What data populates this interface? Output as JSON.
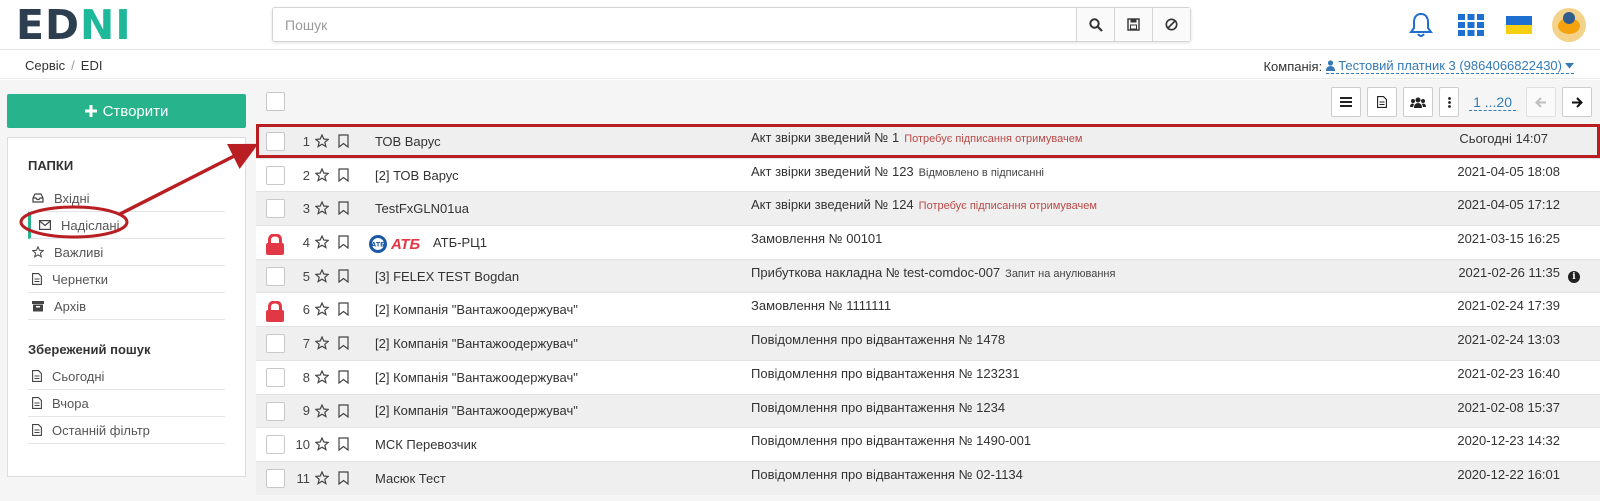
{
  "header": {
    "logo_part1": "ED",
    "logo_part2": "NI",
    "search_placeholder": "Пошук",
    "icons": [
      "search-icon",
      "save-icon",
      "ban-icon",
      "bell-icon",
      "apps-grid-icon",
      "ukraine-flag-icon",
      "user-avatar"
    ]
  },
  "breadcrumb": {
    "items": [
      "Сервіс",
      "EDI"
    ],
    "separator": "/"
  },
  "company": {
    "label": "Компанія:",
    "value": "Тестовий платник 3 (9864066822430)"
  },
  "sidebar": {
    "create_label": "Створити",
    "folders_title": "ПАПКИ",
    "folders": [
      {
        "label": "Вхідні",
        "icon": "inbox-icon"
      },
      {
        "label": "Надіслані",
        "icon": "envelope-icon",
        "active": true
      },
      {
        "label": "Важливі",
        "icon": "star-icon"
      },
      {
        "label": "Чернетки",
        "icon": "file-icon"
      },
      {
        "label": "Архів",
        "icon": "archive-icon"
      }
    ],
    "saved_title": "Збережений пошук",
    "saved": [
      {
        "label": "Сьогодні",
        "icon": "file-icon"
      },
      {
        "label": "Вчора",
        "icon": "file-icon"
      },
      {
        "label": "Останній фільтр",
        "icon": "file-icon"
      }
    ]
  },
  "toolbar": {
    "pager": "1 ...20"
  },
  "rows": [
    {
      "num": "1",
      "sender": "ТОВ Варус",
      "doc": "Акт звірки зведений № 1",
      "status": "Потребує підписання отримувачем",
      "date": "Сьогодні 14:07"
    },
    {
      "num": "2",
      "sender": "[2] ТОВ Варус",
      "doc": "Акт звірки зведений № 123",
      "status": "Відмовлено в підписанні",
      "date": "2021-04-05 18:08"
    },
    {
      "num": "3",
      "sender": "TestFxGLN01ua",
      "doc": "Акт звірки зведений № 124",
      "status": "Потребує підписання отримувачем",
      "date": "2021-04-05 17:12"
    },
    {
      "num": "4",
      "sender": "АТБ-РЦ1",
      "logo": "АТБ",
      "doc": "Замовлення № 00101",
      "status": "",
      "date": "2021-03-15 16:25"
    },
    {
      "num": "5",
      "sender": "[3] FELEX TEST Bogdan",
      "doc": "Прибуткова накладна № test-comdoc-007",
      "status": "Запит на анулювання",
      "date": "2021-02-26 11:35"
    },
    {
      "num": "6",
      "sender": "[2] Компанія \"Вантажоодержувач\"",
      "doc": "Замовлення № 1111111",
      "status": "",
      "date": "2021-02-24 17:39"
    },
    {
      "num": "7",
      "sender": "[2] Компанія \"Вантажоодержувач\"",
      "doc": "Повідомлення про відвантаження № 1478",
      "status": "",
      "date": "2021-02-24 13:03"
    },
    {
      "num": "8",
      "sender": "[2] Компанія \"Вантажоодержувач\"",
      "doc": "Повідомлення про відвантаження № 123231",
      "status": "",
      "date": "2021-02-23 16:40"
    },
    {
      "num": "9",
      "sender": "[2] Компанія \"Вантажоодержувач\"",
      "doc": "Повідомлення про відвантаження № 1234",
      "status": "",
      "date": "2021-02-08 15:37"
    },
    {
      "num": "10",
      "sender": "МСК Перевозчик",
      "doc": "Повідомлення про відвантаження № 1490-001",
      "status": "",
      "date": "2020-12-23 14:32"
    },
    {
      "num": "11",
      "sender": "Масюк Тест",
      "doc": "Повідомлення про відвантаження № 02-1134",
      "status": "",
      "date": "2020-12-22 16:01"
    }
  ],
  "colors": {
    "accent": "#27b48c",
    "annotation": "#b81e22",
    "link": "#337ab7",
    "status_red": "#b94a48"
  }
}
